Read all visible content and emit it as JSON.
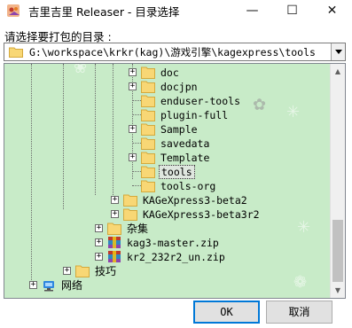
{
  "window": {
    "title": "吉里吉里 Releaser - 目录选择",
    "min_symbol": "—",
    "max_symbol": "☐",
    "close_symbol": "✕"
  },
  "dialog": {
    "prompt": "请选择要打包的目录 :",
    "path": "G:\\workspace\\krkr(kag)\\游戏引擎\\kagexpress\\tools",
    "ok_label": "OK",
    "cancel_label": "取消"
  },
  "tree": {
    "items": [
      {
        "label": "doc",
        "icon": "folder-icon",
        "expandable": true,
        "selected": false
      },
      {
        "label": "docjpn",
        "icon": "folder-icon",
        "expandable": true,
        "selected": false
      },
      {
        "label": "enduser-tools",
        "icon": "folder-icon",
        "expandable": false,
        "selected": false
      },
      {
        "label": "plugin-full",
        "icon": "folder-icon",
        "expandable": false,
        "selected": false
      },
      {
        "label": "Sample",
        "icon": "folder-icon",
        "expandable": true,
        "selected": false
      },
      {
        "label": "savedata",
        "icon": "folder-icon",
        "expandable": false,
        "selected": false
      },
      {
        "label": "Template",
        "icon": "folder-icon",
        "expandable": true,
        "selected": false
      },
      {
        "label": "tools",
        "icon": "folder-icon",
        "expandable": false,
        "selected": true
      },
      {
        "label": "tools-org",
        "icon": "folder-icon",
        "expandable": false,
        "selected": false
      },
      {
        "label": "KAGeXpress3-beta2",
        "icon": "folder-icon",
        "expandable": true,
        "selected": false
      },
      {
        "label": "KAGeXpress3-beta3r2",
        "icon": "folder-icon",
        "expandable": true,
        "selected": false
      },
      {
        "label": "杂集",
        "icon": "folder-icon",
        "expandable": true,
        "selected": false
      },
      {
        "label": "kag3-master.zip",
        "icon": "zip-archive-icon",
        "expandable": true,
        "selected": false
      },
      {
        "label": "kr2_232r2_un.zip",
        "icon": "zip-archive-icon",
        "expandable": true,
        "selected": false
      },
      {
        "label": "技巧",
        "icon": "folder-icon",
        "expandable": true,
        "selected": false
      },
      {
        "label": "网络",
        "icon": "network-icon",
        "expandable": true,
        "selected": false
      }
    ]
  },
  "colors": {
    "tree_background": "#c8ebc8",
    "folder": "#f8d775",
    "default_button_border": "#0078d7"
  }
}
